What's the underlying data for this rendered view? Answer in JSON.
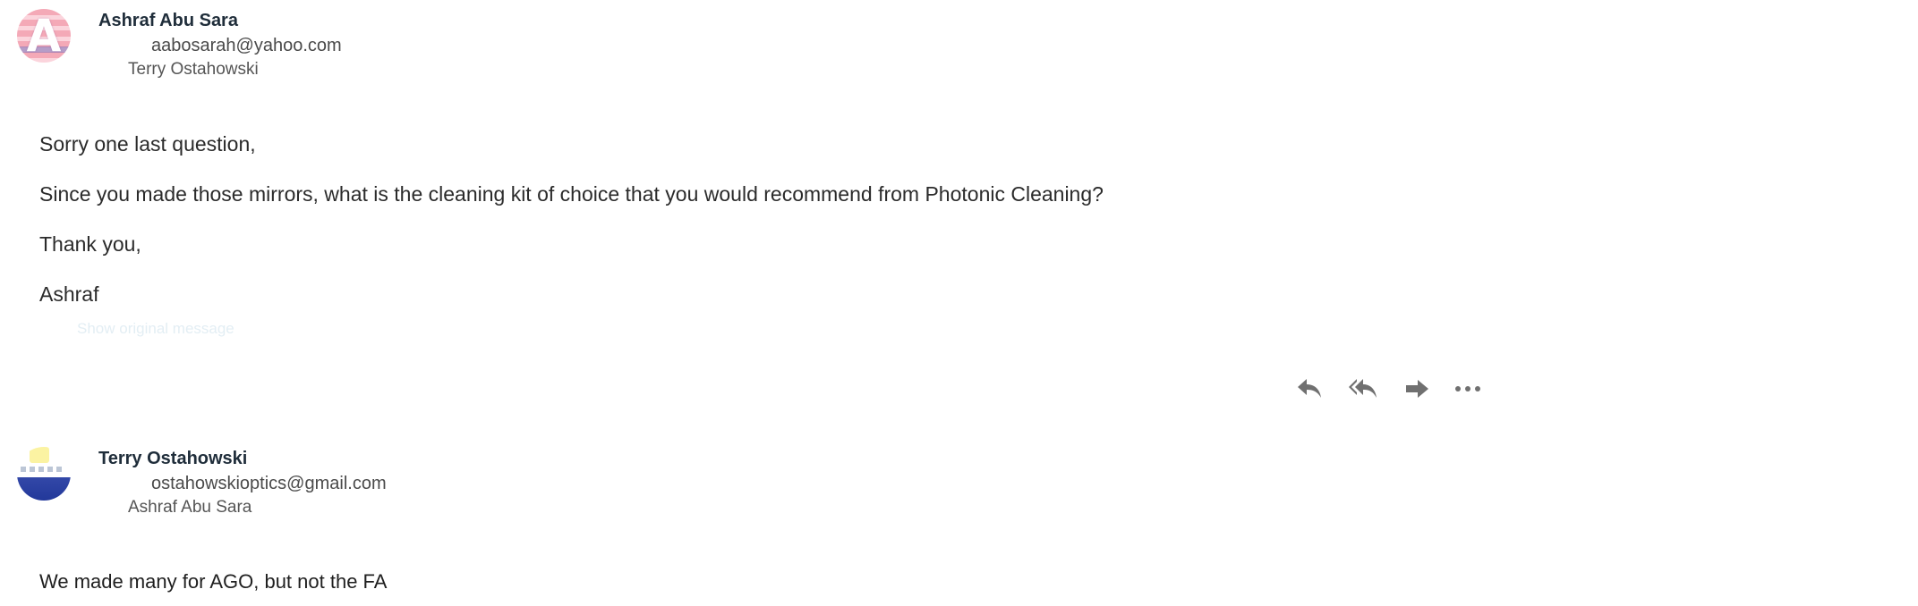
{
  "messages": [
    {
      "sender": "Ashraf Abu Sara",
      "email": "aabosarah@yahoo.com",
      "recipient": "Terry Ostahowski",
      "avatar_letter": "A",
      "body": [
        "Sorry one last question,",
        "Since you made those mirrors, what is the cleaning kit of choice that you would recommend from Photonic Cleaning?",
        "Thank you,",
        "Ashraf"
      ],
      "show_original": "Show original message"
    },
    {
      "sender": "Terry Ostahowski",
      "email": "ostahowskioptics@gmail.com",
      "recipient": "Ashraf Abu Sara",
      "body": [
        "We made many for AGO, but not the FA"
      ]
    }
  ],
  "actions": [
    {
      "name": "reply",
      "icon": "reply-icon"
    },
    {
      "name": "reply-all",
      "icon": "reply-all-icon"
    },
    {
      "name": "forward",
      "icon": "forward-icon"
    },
    {
      "name": "more",
      "icon": "more-icon"
    }
  ],
  "colors": {
    "icon_gray": "#707070",
    "sender_text": "#1f2d3a",
    "avatar_a_pink": "#f4a9b7",
    "avatar_t_blue": "#22389a"
  }
}
